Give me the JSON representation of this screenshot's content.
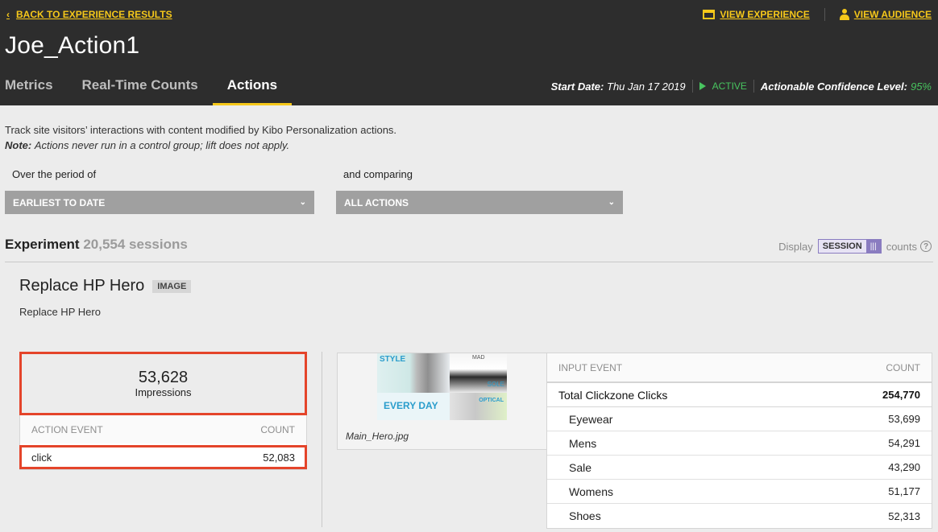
{
  "header": {
    "back_label": "BACK TO EXPERIENCE RESULTS",
    "view_experience_label": "VIEW EXPERIENCE",
    "view_audience_label": "VIEW AUDIENCE",
    "title": "Joe_Action1",
    "tabs": [
      {
        "label": "Metrics",
        "active": false
      },
      {
        "label": "Real-Time Counts",
        "active": false
      },
      {
        "label": "Actions",
        "active": true
      }
    ],
    "start_date_label": "Start Date:",
    "start_date_value": "Thu Jan 17 2019",
    "status": "ACTIVE",
    "confidence_label": "Actionable Confidence Level:",
    "confidence_value": "95%"
  },
  "description": {
    "text": "Track site visitors’ interactions with content modified by Kibo Personalization actions.",
    "note_label": "Note:",
    "note_text": "Actions never run in a control group; lift does not apply."
  },
  "filters": {
    "period_label": "Over the period of",
    "period_value": "EARLIEST TO DATE",
    "compare_label": "and comparing",
    "compare_value": "ALL ACTIONS"
  },
  "experiment": {
    "label": "Experiment",
    "sessions": "20,554 sessions",
    "display_label": "Display",
    "display_mode": "SESSION",
    "counts_label": "counts",
    "help": "?"
  },
  "action": {
    "title": "Replace HP Hero",
    "badge": "IMAGE",
    "subtitle": "Replace HP Hero",
    "impressions_value": "53,628",
    "impressions_label": "Impressions",
    "event_table": {
      "col_event": "ACTION EVENT",
      "col_count": "COUNT",
      "rows": [
        {
          "event": "click",
          "count": "52,083"
        }
      ]
    },
    "image": {
      "caption": "Main_Hero.jpg",
      "thumb_text_1": "STYLE",
      "thumb_text_2": "MAD",
      "thumb_text_3": "EVERY DAY",
      "thumb_text_4": "OPTICAL",
      "thumb_text_5": "SOLE"
    },
    "input_table": {
      "col_event": "INPUT EVENT",
      "col_count": "COUNT",
      "total": {
        "event": "Total Clickzone Clicks",
        "count": "254,770"
      },
      "rows": [
        {
          "event": "Eyewear",
          "count": "53,699"
        },
        {
          "event": "Mens",
          "count": "54,291"
        },
        {
          "event": "Sale",
          "count": "43,290"
        },
        {
          "event": "Womens",
          "count": "51,177"
        },
        {
          "event": "Shoes",
          "count": "52,313"
        }
      ]
    }
  },
  "colors": {
    "accent": "#f6c81a",
    "active": "#48c45f",
    "highlight": "#e4442a",
    "header_bg": "#2d2d2d"
  }
}
